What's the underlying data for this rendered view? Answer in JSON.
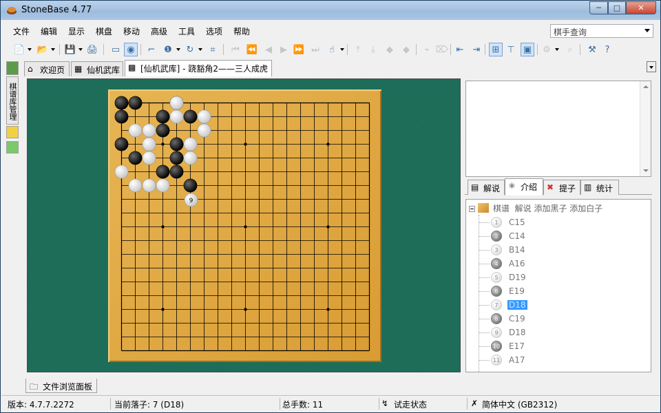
{
  "window": {
    "title": "StoneBase 4.77",
    "min_label": "─",
    "max_label": "□",
    "close_label": "✕"
  },
  "menu": [
    "文件",
    "编辑",
    "显示",
    "棋盘",
    "移动",
    "高级",
    "工具",
    "选项",
    "帮助"
  ],
  "player_search": {
    "value": "棋手查询"
  },
  "left_strip": {
    "label": "棋谱库管理"
  },
  "doc_tabs": [
    {
      "label": "欢迎页",
      "icon": "home-icon"
    },
    {
      "label": "仙机武库",
      "icon": "database-icon"
    },
    {
      "label": "[仙机武库] - 跷豁角2——三人成虎",
      "icon": "board-icon"
    }
  ],
  "board": {
    "size": 19,
    "black_stones": [
      "A19",
      "B19",
      "E19",
      "A18",
      "D18",
      "F18",
      "D17",
      "A16",
      "E16",
      "B15",
      "E15",
      "D14",
      "E14",
      "F13"
    ],
    "white_stones": [
      "E19",
      "E18",
      "G18",
      "B17",
      "C17",
      "G17",
      "C16",
      "F16",
      "C15",
      "F15",
      "A14",
      "B13",
      "C13",
      "D13"
    ],
    "white_stones_note": "",
    "numbered_stone": {
      "label": "9",
      "color": "white"
    },
    "star_points": [
      "D16",
      "K16",
      "Q16",
      "D10",
      "K10",
      "Q10",
      "D4",
      "K4",
      "Q4"
    ]
  },
  "right_tabs": [
    {
      "label": "解说",
      "icon": "comment-icon",
      "active": false
    },
    {
      "label": "介绍",
      "icon": "info-icon",
      "active": true
    },
    {
      "label": "提子",
      "icon": "capture-icon",
      "active": false
    },
    {
      "label": "统计",
      "icon": "stats-icon",
      "active": false
    }
  ],
  "tree": {
    "root_label": "棋谱",
    "root_actions": "解说 添加黑子 添加白子",
    "moves": [
      {
        "n": "1",
        "color": "w",
        "coord": "C15",
        "selected": false
      },
      {
        "n": "2",
        "color": "b",
        "coord": "C14",
        "selected": false
      },
      {
        "n": "3",
        "color": "w",
        "coord": "B14",
        "selected": false
      },
      {
        "n": "4",
        "color": "b",
        "coord": "A16",
        "selected": false
      },
      {
        "n": "5",
        "color": "w",
        "coord": "D19",
        "selected": false
      },
      {
        "n": "6",
        "color": "b",
        "coord": "E19",
        "selected": false
      },
      {
        "n": "7",
        "color": "w",
        "coord": "D18",
        "selected": true
      },
      {
        "n": "8",
        "color": "b",
        "coord": "C19",
        "selected": false
      },
      {
        "n": "9",
        "color": "w",
        "coord": "D18",
        "selected": false
      },
      {
        "n": "10",
        "color": "b",
        "coord": "E17",
        "selected": false
      },
      {
        "n": "11",
        "color": "w",
        "coord": "A17",
        "selected": false
      }
    ]
  },
  "bottom_tab": {
    "label": "文件浏览面板"
  },
  "status": {
    "version": "版本: 4.7.7.2272",
    "current_move": "当前落子: 7 (D18)",
    "total_moves": "总手数: 11",
    "mode": "试走状态",
    "language": "简体中文 (GB2312)"
  },
  "colors": {
    "board": "#dfa741",
    "felt": "#1b6b57",
    "selection": "#3399ff"
  }
}
